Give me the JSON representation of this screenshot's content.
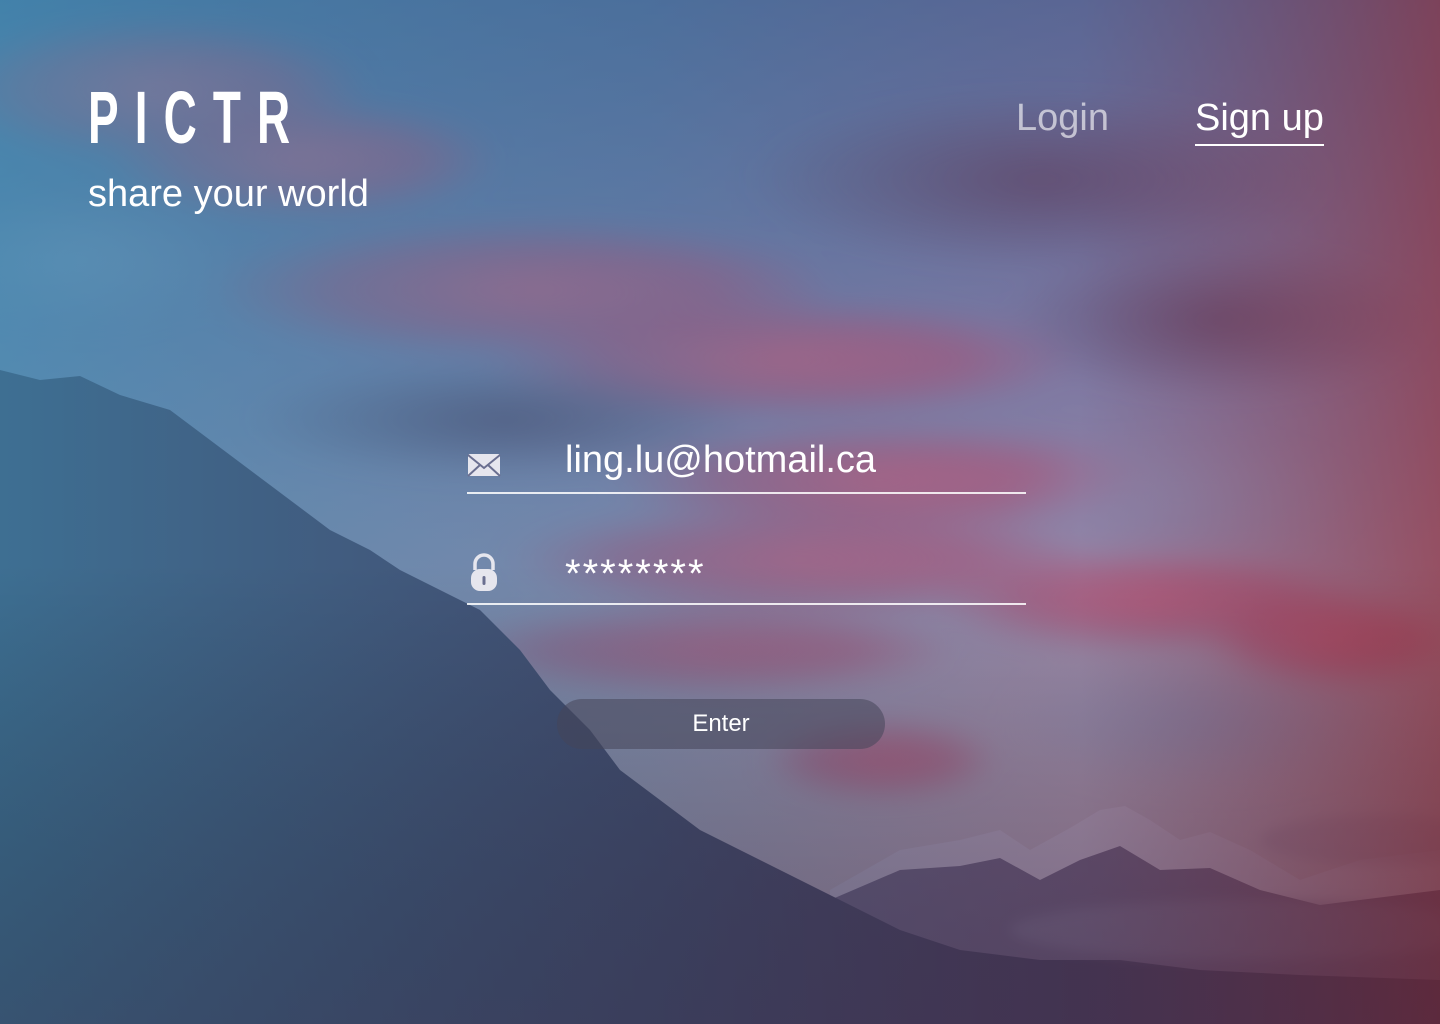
{
  "brand": {
    "logo": "PICTR",
    "tagline": "share your world"
  },
  "nav": {
    "login_label": "Login",
    "signup_label": "Sign up",
    "active": "signup"
  },
  "form": {
    "email": {
      "value": "ling.lu@hotmail.ca",
      "icon": "envelope-icon"
    },
    "password": {
      "value": "********",
      "icon": "lock-icon"
    },
    "submit_label": "Enter"
  },
  "colors": {
    "text": "#ffffff",
    "overlay_left": "#3f80a6",
    "overlay_right": "#8c2c3c",
    "button_bg": "#46465a"
  }
}
